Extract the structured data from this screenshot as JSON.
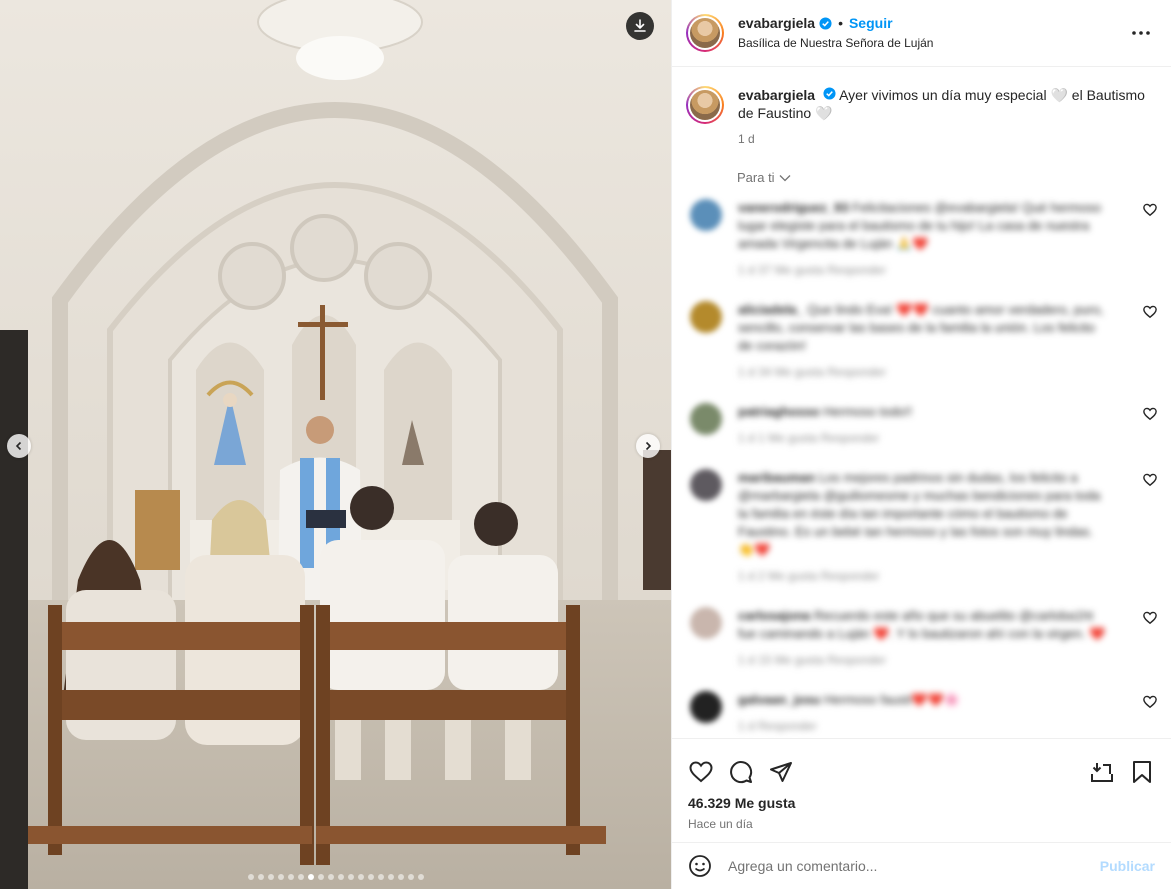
{
  "post": {
    "username": "evabargiela",
    "follow_label": "Seguir",
    "separator": "•",
    "location": "Basílica de Nuestra Señora de Luján",
    "caption_text": "Ayer vivimos un día muy especial 🤍 el Bautismo de Faustino 🤍",
    "caption_time": "1 d",
    "sort_label": "Para ti",
    "likes": "46.329 Me gusta",
    "posted_when": "Hace un día"
  },
  "comments": [
    {
      "user": "vanerodriguez_93",
      "text": "Felicitaciones @evabargiela! Qué hermoso lugar elegiste para el bautismo de tu hijo! La casa de nuestra amada Virgencita de Luján 🙏❤️",
      "meta": "1 d   37 Me gusta   Responder"
    },
    {
      "user": "aliciadela_",
      "text": "Que lindo Eva! ❤️❤️ cuanto amor verdadero, puro, sencillo, conservar las bases de la familia la unión. Los felicito de corazón!",
      "meta": "1 d   34 Me gusta   Responder"
    },
    {
      "user": "patriaghosso",
      "text": "Hermoso todo!!",
      "meta": "1 d   1 Me gusta   Responder"
    },
    {
      "user": "maribauman",
      "text": "Los mejores padrinos sin dudas, los felicito a @marbargiela @guiliomesme y muchas bendiciones para toda la familia en éste día tan importante cómo el bautismo de Faustino. Es un bebé tan hermoso y las fotos son muy lindas. 👏❤️",
      "meta": "1 d   2 Me gusta   Responder"
    },
    {
      "user": "carlosajona",
      "text": "Recuerdo este año que su abuelito @carloba1ht fue caminando a Luján ❤️. Y lo bautizaron ahí con la virgen. ❤️",
      "meta": "1 d   15 Me gusta   Responder"
    },
    {
      "user": "galvaan_josu",
      "text": "Hermoso fausti❤️❤️🌸",
      "meta": "1 d   Responder"
    }
  ],
  "comment_input": {
    "placeholder": "Agrega un comentario...",
    "publish_label": "Publicar"
  },
  "carousel": {
    "total_slides": 18,
    "active_index": 6
  },
  "icons": {
    "download": "download-icon",
    "more": "more-options-icon",
    "like": "heart-icon",
    "comment": "comment-icon",
    "share": "share-icon",
    "save": "bookmark-icon",
    "add_to_collection": "save-to-collection-icon",
    "emoji": "emoji-icon",
    "verified": "verified-badge-icon"
  },
  "colors": {
    "accent": "#0095f6",
    "publish_disabled": "#b3dbff",
    "secondary_text": "#737373"
  }
}
